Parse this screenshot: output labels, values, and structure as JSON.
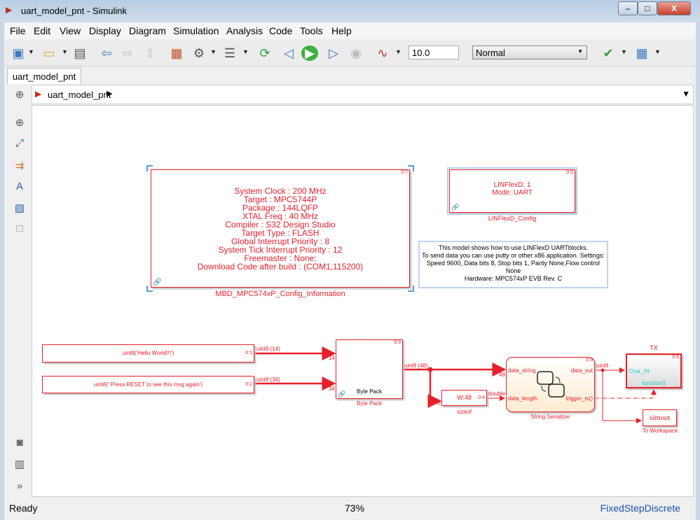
{
  "window": {
    "title": "uart_model_pnt - Simulink",
    "controls": [
      "minimize",
      "maximize",
      "close"
    ]
  },
  "menu": [
    "File",
    "Edit",
    "View",
    "Display",
    "Diagram",
    "Simulation",
    "Analysis",
    "Code",
    "Tools",
    "Help"
  ],
  "toolbar": {
    "stop_time": "10.0",
    "sim_mode": "Normal",
    "icons": [
      "new-model-icon",
      "open-icon",
      "save-icon",
      "back-icon",
      "forward-icon",
      "up-icon",
      "library-browser-icon",
      "model-config-icon",
      "model-explorer-icon",
      "update-diagram-icon",
      "step-back-icon",
      "run-icon",
      "step-forward-icon",
      "stop-icon",
      "scope-icon",
      "model-advisor-icon",
      "build-icon"
    ]
  },
  "tab": "uart_model_pnt",
  "breadcrumb": "uart_model_pnt",
  "diagram": {
    "info_block": {
      "tag": "0:7",
      "lines": [
        "System Clock : 200 MHz",
        "Target : MPC5744P",
        "Package : 144LQFP",
        "XTAL Freq : 40 MHz",
        "Compiler : S32 Design Studio",
        "Target Type : FLASH",
        "Global Interrupt Priority : 8",
        "System Tick Interrupt Priority : 12",
        "Freemaster : None;",
        "Download Code after build : (COM1,115200)"
      ],
      "label": "MBD_MPC574xP_Config_Information"
    },
    "lin_block": {
      "tag": "0:0",
      "lines": [
        "LINFlexD: 1",
        "Mode: UART"
      ],
      "label": "LINFlexD_Config"
    },
    "note": [
      "This model shows how to use LINFlexD UARTblocks.",
      "To send data you can use putty or other x86 application. Settings:",
      "Speed 9600, Data bits 8, Stop bits 1, Parity None,Flow control None",
      "Hardware: MPC574xP EVB Rev. C"
    ],
    "const1": {
      "text": "uint8('Hello World!!!')",
      "tag": "0:1",
      "signal": "uint8 (14)",
      "width": "14"
    },
    "const2": {
      "text": "uint8(' Press RESET to see this msg again')",
      "tag": "0:2",
      "signal": "uint8 (34)",
      "width": "34"
    },
    "bytepack": {
      "text": "Byte Pack",
      "tag": "0:3",
      "label": "Byte Pack",
      "signal": "uint8 (48)"
    },
    "sizeof": {
      "text": "W:48",
      "tag": "0:4",
      "label": "sizeof",
      "in_width": "48",
      "signal": "double"
    },
    "serializer": {
      "tag": "0:5",
      "label": "String Serializer",
      "in1": "data_string",
      "in2": "data_length",
      "out1": "data_out",
      "out2": "trigger_tx()",
      "in_width": "48",
      "signal": "uint8"
    },
    "tx": {
      "title": "TX",
      "tag": "0:5",
      "in": "Char_IN",
      "trigger": "function()"
    },
    "workspace": {
      "text": "simout",
      "label": "To Workspace"
    }
  },
  "status": {
    "left": "Ready",
    "zoom": "73%",
    "solver": "FixedStepDiscrete"
  },
  "colors": {
    "block": "#e8202a",
    "selection": "#5b9bd5",
    "canvas": "#ffffff"
  }
}
